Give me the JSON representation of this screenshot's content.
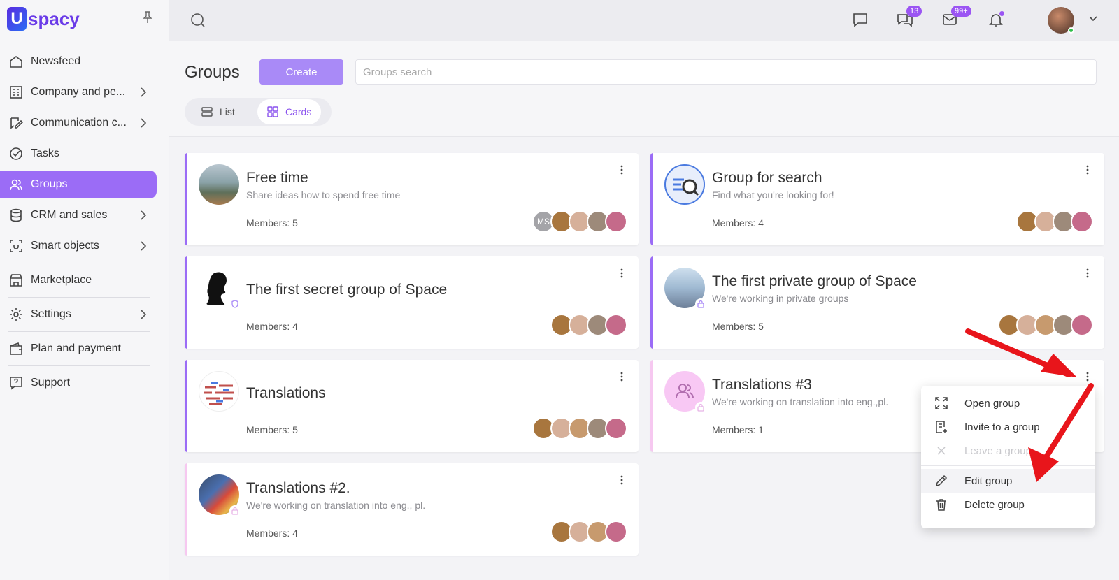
{
  "app": {
    "logo_letter": "U",
    "logo_text": "spacy"
  },
  "sidebar": {
    "items": [
      {
        "label": "Newsfeed",
        "icon": "home-icon"
      },
      {
        "label": "Company and pe...",
        "icon": "building-icon",
        "has_submenu": true
      },
      {
        "label": "Communication c...",
        "icon": "chat-edit-icon",
        "has_submenu": true
      },
      {
        "label": "Tasks",
        "icon": "check-circle-icon"
      },
      {
        "label": "Groups",
        "icon": "users-icon",
        "active": true
      },
      {
        "label": "CRM and sales",
        "icon": "database-icon",
        "has_submenu": true
      },
      {
        "label": "Smart objects",
        "icon": "scan-icon",
        "has_submenu": true
      },
      {
        "label": "Marketplace",
        "icon": "store-icon"
      },
      {
        "label": "Settings",
        "icon": "gear-icon",
        "has_submenu": true
      },
      {
        "label": "Plan and payment",
        "icon": "wallet-icon"
      },
      {
        "label": "Support",
        "icon": "help-icon"
      }
    ]
  },
  "topbar": {
    "chat_badge": "13",
    "mail_badge": "99+"
  },
  "header": {
    "title": "Groups",
    "create_label": "Create",
    "search_placeholder": "Groups search",
    "view_list": "List",
    "view_cards": "Cards"
  },
  "cards": [
    {
      "title": "Free time",
      "desc": "Share ideas how to spend free time",
      "members": "Members: 5",
      "initials": "MS"
    },
    {
      "title": "Group for search",
      "desc": "Find what you're looking for!",
      "members": "Members: 4"
    },
    {
      "title": "The first secret group of Space",
      "desc": "",
      "members": "Members: 4"
    },
    {
      "title": "The first private group of Space",
      "desc": "We're working in private groups",
      "members": "Members: 5"
    },
    {
      "title": "Translations",
      "desc": "",
      "members": "Members: 5"
    },
    {
      "title": "Translations #3",
      "desc": "We're working on translation into eng.,pl.",
      "members": "Members: 1"
    },
    {
      "title": "Translations #2.",
      "desc": "We're working on translation into eng., pl.",
      "members": "Members: 4"
    }
  ],
  "menu": {
    "items": [
      {
        "label": "Open group",
        "icon": "expand-icon"
      },
      {
        "label": "Invite to a group",
        "icon": "invite-icon"
      },
      {
        "label": "Leave a group",
        "icon": "close-icon",
        "disabled": true
      },
      {
        "label": "Edit group",
        "icon": "pencil-icon"
      },
      {
        "label": "Delete group",
        "icon": "trash-icon"
      }
    ]
  },
  "colors": {
    "accent": "#9b6cf6",
    "badge": "#9b55f3",
    "arrow": "#e8151b"
  }
}
